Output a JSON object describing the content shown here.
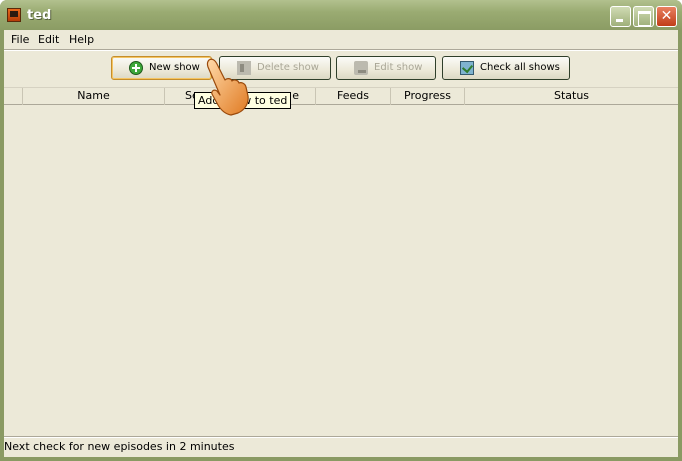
{
  "window": {
    "title": "ted"
  },
  "menu": [
    {
      "label": "File"
    },
    {
      "label": "Edit"
    },
    {
      "label": "Help"
    }
  ],
  "toolbar": {
    "new_show": {
      "label": "New show",
      "icon": "add-icon",
      "enabled": true
    },
    "delete_show": {
      "label": "Delete show",
      "icon": "delete-icon",
      "enabled": false
    },
    "edit_show": {
      "label": "Edit show",
      "icon": "edit-icon",
      "enabled": false
    },
    "check_all": {
      "label": "Check all shows",
      "icon": "check-icon",
      "enabled": true
    }
  },
  "table": {
    "columns": [
      "",
      "Name",
      "Se",
      "e",
      "Feeds",
      "Progress",
      "Status"
    ],
    "rows": []
  },
  "tooltip": {
    "text": "Add show to ted"
  },
  "status": {
    "text": "Next check for new episodes in 2 minutes"
  },
  "colors": {
    "titlebar": "#9aab72",
    "client": "#ece9d8",
    "tooltip_bg": "#ffffe1"
  }
}
